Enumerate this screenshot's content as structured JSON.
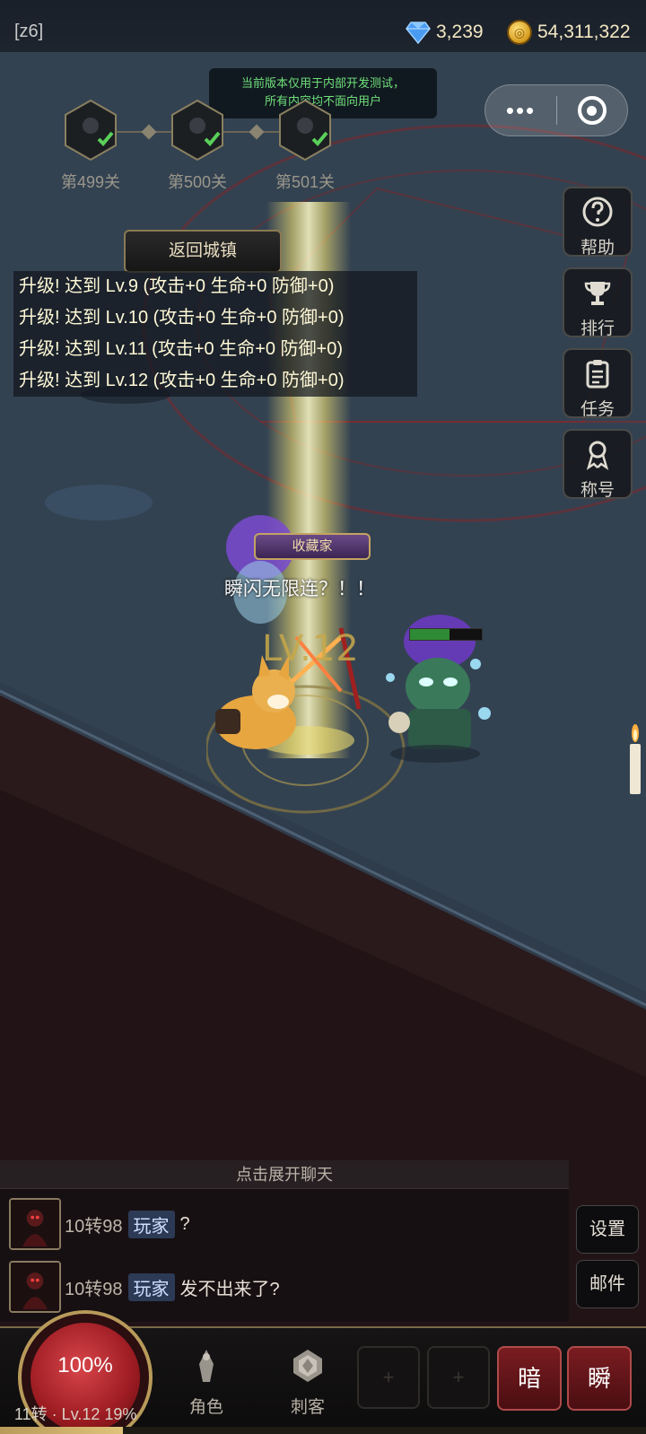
{
  "server_tag": "[z6]",
  "currency": {
    "diamonds": "3,239",
    "gold": "54,311,322"
  },
  "notice": {
    "line1": "当前版本仅用于内部开发测试，",
    "line2": "所有内容均不面向用户"
  },
  "stages": [
    {
      "label": "第499关",
      "cleared": true
    },
    {
      "label": "第500关",
      "cleared": true
    },
    {
      "label": "第501关",
      "cleared": true
    }
  ],
  "return_button": "返回城镇",
  "logs": [
    "升级! 达到 Lv.9 (攻击+0 生命+0 防御+0)",
    "升级! 达到 Lv.10 (攻击+0 生命+0 防御+0)",
    "升级! 达到 Lv.11 (攻击+0 生命+0 防御+0)",
    "升级! 达到 Lv.12 (攻击+0 生命+0 防御+0)"
  ],
  "side_buttons": [
    {
      "id": "help",
      "label": "帮助",
      "icon": "help-icon"
    },
    {
      "id": "rank",
      "label": "排行",
      "icon": "trophy-icon"
    },
    {
      "id": "quest",
      "label": "任务",
      "icon": "clipboard-icon"
    },
    {
      "id": "title",
      "label": "称号",
      "icon": "medal-icon"
    }
  ],
  "battle": {
    "title_badge": "收藏家",
    "shout": "瞬闪无限连？！！",
    "level_text": "LV.12",
    "enemy_hp": 0.55
  },
  "chat": {
    "header": "点击展开聊天",
    "messages": [
      {
        "rank": "10转98",
        "name": "玩家",
        "text": "?"
      },
      {
        "rank": "10转98",
        "name": "玩家",
        "text": "发不出来了?"
      }
    ],
    "settings": "设置",
    "mail": "邮件"
  },
  "bottom": {
    "orb_percent": "100%",
    "caption": "11转 · Lv.12  19%",
    "xp_fraction": 0.19,
    "nav": [
      {
        "label": "角色",
        "icon": "character-icon"
      },
      {
        "label": "刺客",
        "icon": "assassin-icon"
      }
    ],
    "slots": [
      "+",
      "+"
    ],
    "skills": [
      "暗",
      "瞬"
    ]
  },
  "colors": {
    "accent_gold": "#b89a5a",
    "notice_green": "#6fe07a",
    "skill_red": "#7a1c20"
  }
}
